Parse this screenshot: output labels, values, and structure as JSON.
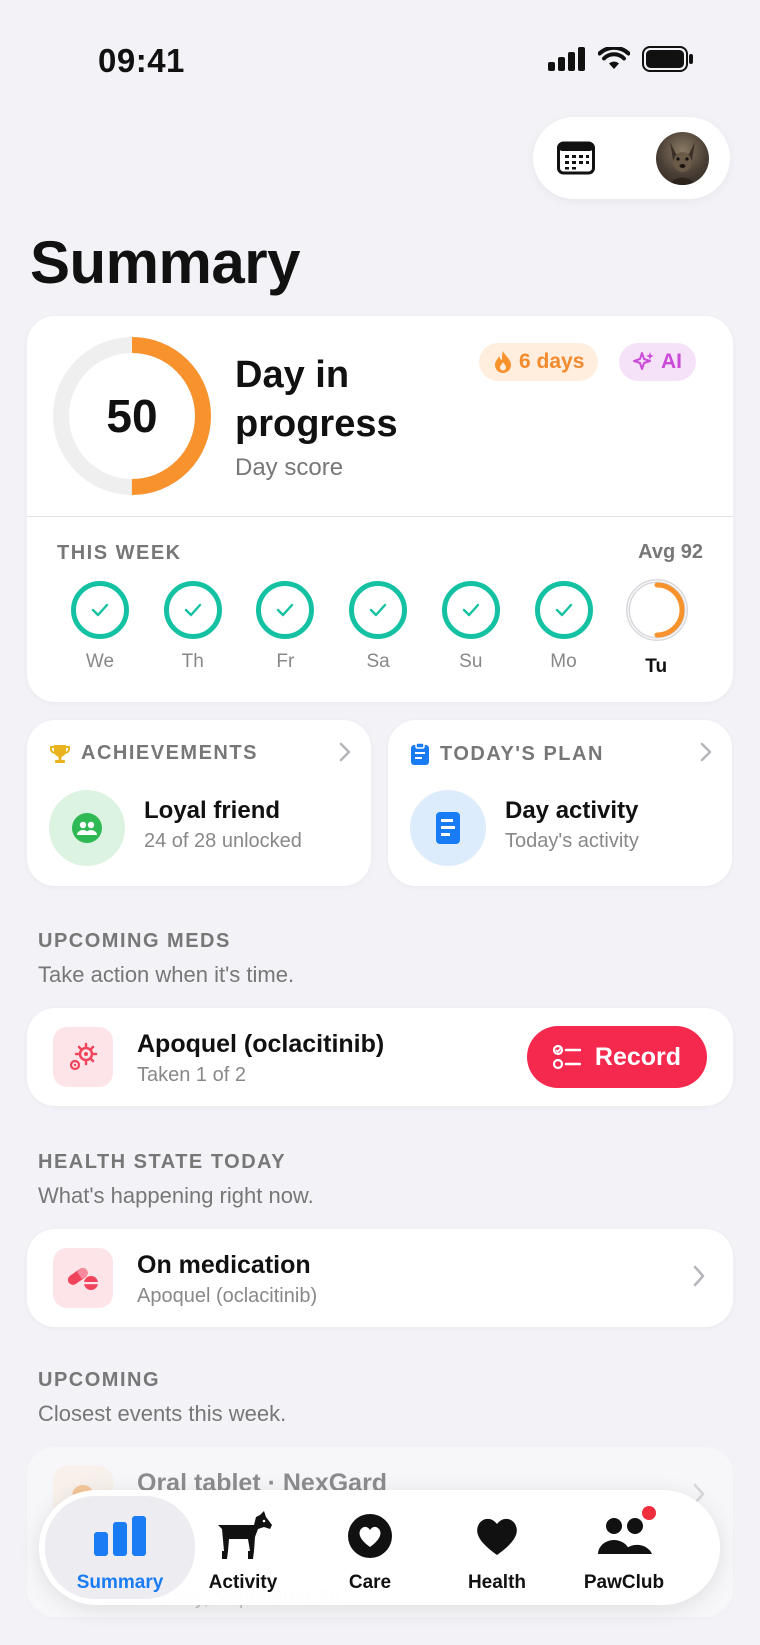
{
  "status_bar": {
    "time": "09:41"
  },
  "header": {
    "title": "Summary"
  },
  "score_card": {
    "score": "50",
    "score_fraction": 0.5,
    "title": "Day in progress",
    "subtitle": "Day score",
    "streak_badge": "6 days",
    "ai_badge": "AI",
    "week_label": "THIS WEEK",
    "week_avg": "Avg 92",
    "days": [
      {
        "label": "We",
        "status": "done"
      },
      {
        "label": "Th",
        "status": "done"
      },
      {
        "label": "Fr",
        "status": "done"
      },
      {
        "label": "Sa",
        "status": "done"
      },
      {
        "label": "Su",
        "status": "done"
      },
      {
        "label": "Mo",
        "status": "done"
      },
      {
        "label": "Tu",
        "status": "in-progress"
      }
    ]
  },
  "achievements": {
    "heading": "ACHIEVEMENTS",
    "title": "Loyal friend",
    "subtitle": "24 of 28 unlocked"
  },
  "todays_plan": {
    "heading": "TODAY'S PLAN",
    "title": "Day activity",
    "subtitle": "Today's activity"
  },
  "meds_section": {
    "label": "UPCOMING MEDS",
    "sub": "Take action when it's time.",
    "item": {
      "title": "Apoquel (oclacitinib)",
      "subtitle": "Taken 1 of 2",
      "button": "Record"
    }
  },
  "health_section": {
    "label": "HEALTH STATE TODAY",
    "sub": "What's happening right now.",
    "item": {
      "title": "On medication",
      "subtitle": "Apoquel (oclacitinib)"
    }
  },
  "upcoming_section": {
    "label": "UPCOMING",
    "sub": "Closest events this week.",
    "item": {
      "title": "Oral tablet · NexGard",
      "subtitle": "Sunday, September 20"
    }
  },
  "tabbar": {
    "tabs": [
      {
        "label": "Summary",
        "icon": "bar-chart-icon"
      },
      {
        "label": "Activity",
        "icon": "dog-icon"
      },
      {
        "label": "Care",
        "icon": "heart-circle-icon"
      },
      {
        "label": "Health",
        "icon": "heart-icon"
      },
      {
        "label": "PawClub",
        "icon": "people-icon"
      }
    ]
  },
  "colors": {
    "accent_orange": "#f7922d",
    "check_teal": "#14c2a3",
    "record_red": "#f5284e",
    "tab_active_blue": "#1a7cf5"
  }
}
